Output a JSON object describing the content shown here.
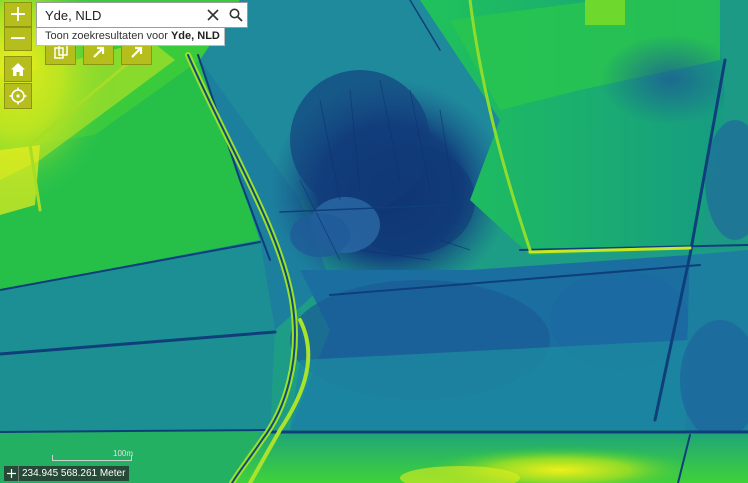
{
  "map": {
    "colors": {
      "low": "#103f7c",
      "lowmid": "#1e7ea0",
      "mid": "#12b66c",
      "midhigh": "#45d62c",
      "high": "#f3ee19",
      "ridge": "#a7e22a"
    }
  },
  "controls": {
    "zoom_in_label": "+",
    "zoom_out_label": "−",
    "home_icon": "home-icon",
    "locate_icon": "locate-icon",
    "tools": [
      {
        "icon": "copy-icon"
      },
      {
        "icon": "arrow-up-right-icon"
      },
      {
        "icon": "arrow-up-right-icon"
      }
    ]
  },
  "search": {
    "value": "Yde, NLD",
    "suggestion_prefix": "Toon zoekresultaten voor ",
    "suggestion_term": "Yde, NLD",
    "clear_icon": "close-icon",
    "search_icon": "search-icon"
  },
  "scale": {
    "label": "100m"
  },
  "coordinates": {
    "text": "234.945 568.261 Meter"
  }
}
